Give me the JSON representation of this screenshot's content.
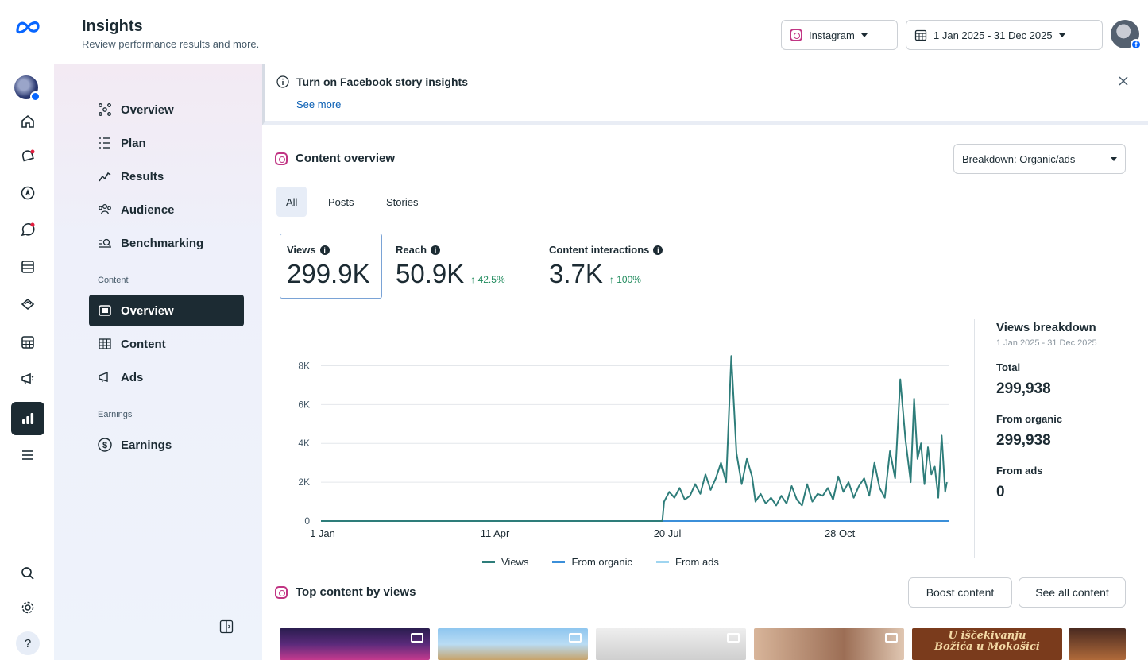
{
  "header": {
    "title": "Insights",
    "subtitle": "Review performance results and more.",
    "platform_select": "Instagram",
    "date_range": "1 Jan 2025 - 31 Dec 2025"
  },
  "sidebar": {
    "items": [
      {
        "label": "Overview",
        "icon": "network-icon"
      },
      {
        "label": "Plan",
        "icon": "list-icon"
      },
      {
        "label": "Results",
        "icon": "trend-icon"
      },
      {
        "label": "Audience",
        "icon": "people-icon"
      },
      {
        "label": "Benchmarking",
        "icon": "benchmark-icon"
      }
    ],
    "content_section": "Content",
    "content_items": [
      {
        "label": "Overview",
        "icon": "content-overview-icon",
        "active": true
      },
      {
        "label": "Content",
        "icon": "table-icon"
      },
      {
        "label": "Ads",
        "icon": "megaphone-icon"
      }
    ],
    "earnings_section": "Earnings",
    "earnings_items": [
      {
        "label": "Earnings",
        "icon": "dollar-icon"
      }
    ]
  },
  "banner": {
    "title": "Turn on Facebook story insights",
    "link": "See more"
  },
  "content_overview": {
    "title": "Content overview",
    "breakdown_select": "Breakdown: Organic/ads",
    "tabs": [
      "All",
      "Posts",
      "Stories"
    ],
    "metrics": [
      {
        "label": "Views",
        "value": "299.9K",
        "delta": ""
      },
      {
        "label": "Reach",
        "value": "50.9K",
        "delta": "↑ 42.5%"
      },
      {
        "label": "Content interactions",
        "value": "3.7K",
        "delta": "↑ 100%"
      }
    ]
  },
  "views_breakdown": {
    "title": "Views breakdown",
    "date_range": "1 Jan 2025 - 31 Dec 2025",
    "total_label": "Total",
    "total_value": "299,938",
    "organic_label": "From organic",
    "organic_value": "299,938",
    "ads_label": "From ads",
    "ads_value": "0"
  },
  "top_content": {
    "title": "Top content by views",
    "boost_button": "Boost content",
    "see_all_button": "See all content",
    "thumb_caption": "U iščekivanju Božića u Mokošici"
  },
  "colors": {
    "views": "#2e7d7a",
    "organic": "#3b8fd9",
    "ads": "#9fd5f0",
    "nav_active": "#1c2b33"
  },
  "chart_data": {
    "type": "line",
    "x_ticks": [
      "1 Jan",
      "11 Apr",
      "20 Jul",
      "28 Oct"
    ],
    "y_ticks": [
      "0",
      "2K",
      "4K",
      "6K",
      "8K"
    ],
    "ylim": [
      0,
      9000
    ],
    "xlim": [
      1,
      365
    ],
    "legend": [
      "Views",
      "From organic",
      "From ads"
    ],
    "legend_position": "bottom",
    "series": [
      {
        "name": "Views",
        "x": [
          1,
          199,
          200,
          203,
          206,
          209,
          212,
          215,
          218,
          221,
          224,
          227,
          230,
          233,
          236,
          239,
          242,
          245,
          248,
          251,
          253,
          256,
          259,
          262,
          265,
          268,
          271,
          274,
          277,
          280,
          283,
          286,
          289,
          292,
          295,
          298,
          301,
          304,
          307,
          310,
          313,
          316,
          319,
          322,
          325,
          328,
          331,
          334,
          337,
          340,
          343,
          345,
          347,
          349,
          351,
          353,
          355,
          357,
          359,
          361,
          363,
          364
        ],
        "y": [
          0,
          0,
          1000,
          1500,
          1200,
          1700,
          1100,
          1300,
          1900,
          1400,
          2400,
          1600,
          2200,
          3000,
          2000,
          8500,
          3500,
          1900,
          3200,
          2300,
          1000,
          1400,
          900,
          1200,
          800,
          1300,
          900,
          1800,
          1100,
          800,
          1900,
          1000,
          1400,
          1300,
          1700,
          1100,
          2300,
          1500,
          2000,
          1200,
          1800,
          2200,
          1300,
          3000,
          1700,
          1200,
          3600,
          2200,
          7300,
          4200,
          2000,
          6300,
          3200,
          4000,
          1900,
          3800,
          2400,
          2800,
          1200,
          4400,
          1500,
          2000
        ]
      },
      {
        "name": "From organic",
        "x": [
          1,
          365
        ],
        "y": [
          0,
          0
        ]
      },
      {
        "name": "From ads",
        "x": [
          1,
          365
        ],
        "y": [
          0,
          0
        ]
      }
    ]
  }
}
